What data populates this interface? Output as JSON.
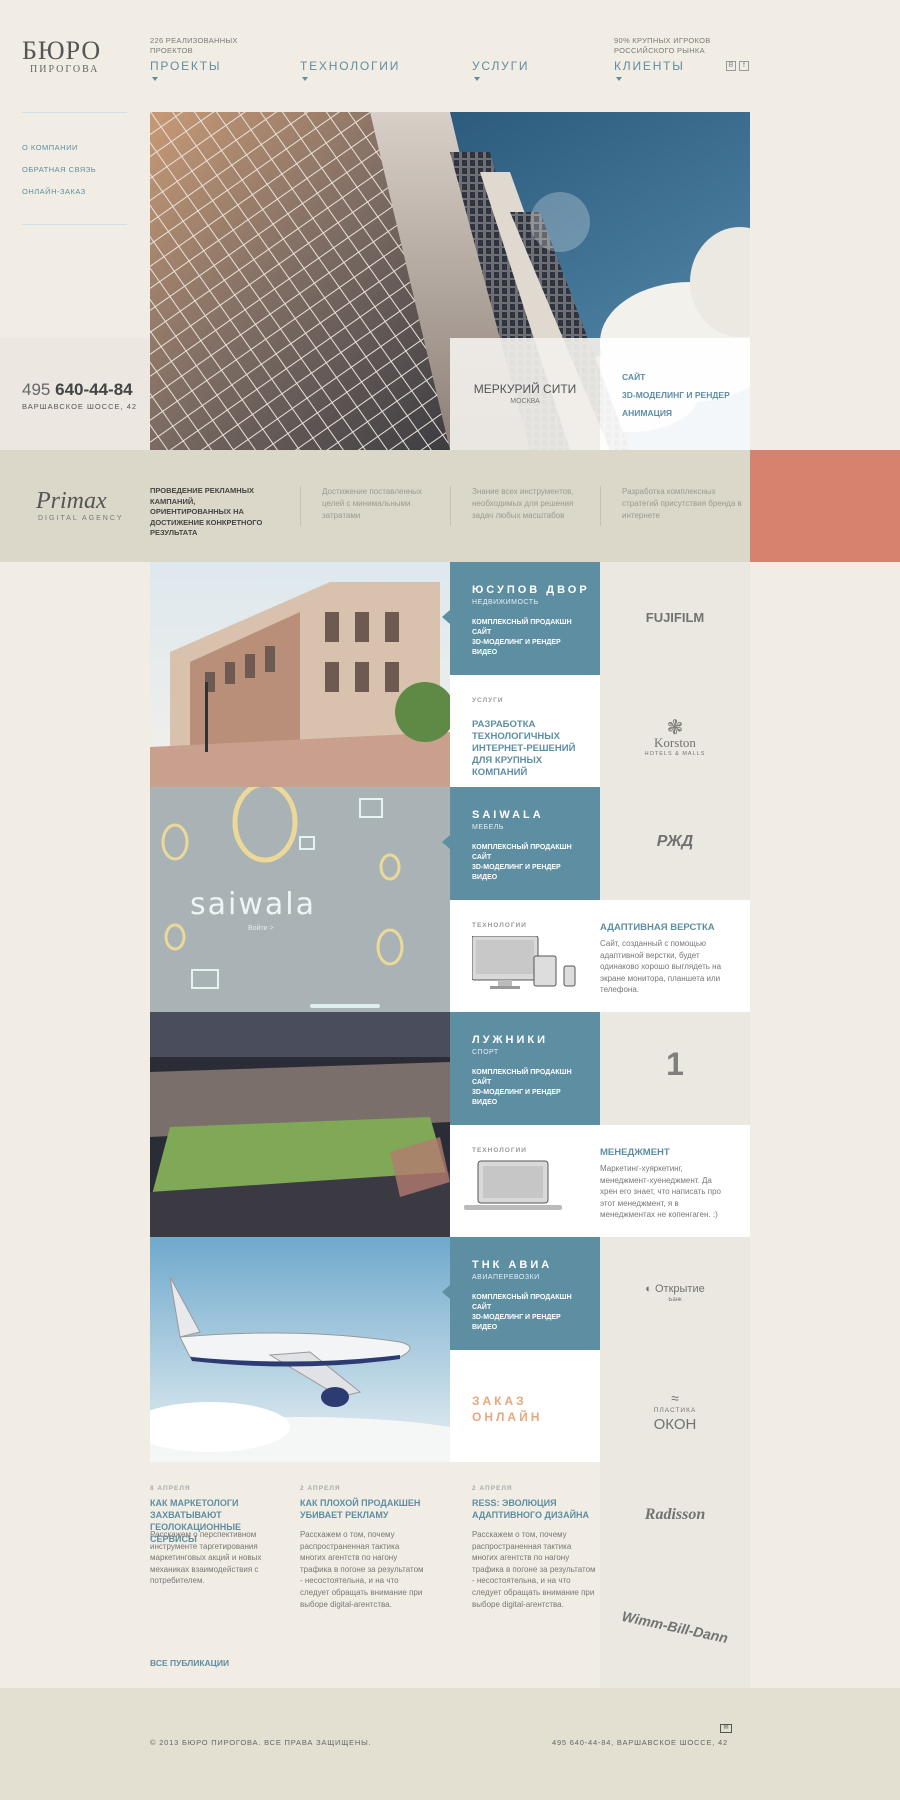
{
  "logo": {
    "line1": "БЮРО",
    "line2": "ПИРОГОВА"
  },
  "nav": [
    {
      "small": "226 РЕАЛИЗОВАННЫХ\nПРОЕКТОВ",
      "label": "ПРОЕКТЫ"
    },
    {
      "small": "",
      "label": "ТЕХНОЛОГИИ"
    },
    {
      "small": "",
      "label": "УСЛУГИ"
    },
    {
      "small": "90% КРУПНЫХ ИГРОКОВ\nРОССИЙСКОГО РЫНКА",
      "label": "КЛИЕНТЫ"
    }
  ],
  "social": [
    "B",
    "f"
  ],
  "sidebar": {
    "links": [
      "О КОМПАНИИ",
      "ОБРАТНАЯ СВЯЗЬ",
      "ОНЛАЙН-ЗАКАЗ"
    ]
  },
  "contact": {
    "phone_prefix": "495",
    "phone": "640-44-84",
    "address": "ВАРШАВСКОЕ ШОССЕ, 42"
  },
  "hero": {
    "title": "МЕРКУРИЙ СИТИ",
    "city": "МОСКВА",
    "links": [
      "САЙТ",
      "3D-МОДЕЛИНГ И РЕНДЕР",
      "АНИМАЦИЯ"
    ]
  },
  "partner": {
    "name": "Primax",
    "tagline": "DIGITAL AGENCY",
    "intro": "ПРОВЕДЕНИЕ РЕКЛАМНЫХ КАМПАНИЙ, ОРИЕНТИРОВАННЫХ НА ДОСТИЖЕНИЕ КОНКРЕТНОГО РЕЗУЛЬТАТА",
    "points": [
      "Достижение поставленных целей с минимальными затратами",
      "Знание всех инструментов, необходимых для решения задач любых масштабов",
      "Разработка комплексных стратегий присутствия бренда в интернете"
    ]
  },
  "projects": [
    {
      "title": "ЮСУПОВ ДВОР",
      "category": "НЕДВИЖИМОСТЬ",
      "services": "КОМПЛЕКСНЫЙ ПРОДАКШН\nСАЙТ\n3D-МОДЕЛИНГ И РЕНДЕР\nВИДЕО"
    },
    {
      "title": "SAIWALA",
      "category": "МЕБЕЛЬ",
      "services": "КОМПЛЕКСНЫЙ ПРОДАКШН\nСАЙТ\n3D-МОДЕЛИНГ И РЕНДЕР\nВИДЕО"
    },
    {
      "title": "ЛУЖНИКИ",
      "category": "СПОРТ",
      "services": "КОМПЛЕКСНЫЙ ПРОДАКШН\nСАЙТ\n3D-МОДЕЛИНГ И РЕНДЕР\nВИДЕО"
    },
    {
      "title": "ТНК АВИА",
      "category": "АВИАПЕРЕВОЗКИ",
      "services": "КОМПЛЕКСНЫЙ ПРОДАКШН\nСАЙТ\n3D-МОДЕЛИНГ И РЕНДЕР\nВИДЕО"
    }
  ],
  "saiwala_image": {
    "word": "saiwala",
    "link": "Войти >"
  },
  "services_box": {
    "label": "УСЛУГИ",
    "text": "РАЗРАБОТКА\nТЕХНОЛОГИЧНЫХ\nИНТЕРНЕТ-РЕШЕНИЙ\nДЛЯ КРУПНЫХ КОМПАНИЙ"
  },
  "tech1": {
    "label": "ТЕХНОЛОГИИ",
    "title": "АДАПТИВНАЯ ВЕРСТКА",
    "text": "Сайт, созданный с помощью адаптивной верстки, будет одинаково хорошо выглядеть на экране монитора, планшета или телефона."
  },
  "tech2": {
    "label": "ТЕХНОЛОГИИ",
    "title": "МЕНЕДЖМЕНТ",
    "text": "Маркетинг-хуяркетинг, менеджмент-хуенеджмент. Да хрен его знает, что написать про этот менеджмент, я в менеджментах не копенгаген. :)"
  },
  "order": {
    "line1": "ЗАКАЗ",
    "line2": "ОНЛАЙН"
  },
  "clients": [
    "FUJIFILM",
    "Korston",
    "HOTELS & MALLS",
    "РЖД",
    "1",
    "Открытие",
    "Банк",
    "ПЛАСТИКА",
    "ОКОН",
    "Radisson",
    "Wimm-Bill-Dann"
  ],
  "news": [
    {
      "date": "8 АПРЕЛЯ",
      "title": "КАК МАРКЕТОЛОГИ ЗАХВАТЫВАЮТ ГЕОЛОКАЦИОННЫЕ СЕРВИСЫ",
      "text": "Расскажем о перспективном инструменте таргетирования маркетинговых акций и новых механиках взаимодействия с потребителем."
    },
    {
      "date": "2 АПРЕЛЯ",
      "title": "КАК ПЛОХОЙ ПРОДАКШЕН УБИВАЕТ РЕКЛАМУ",
      "text": "Расскажем о том, почему распространенная тактика многих агентств по нагону трафика в погоне за результатом - несостоятельна, и на что следует обращать внимание при выборе digital-агентства."
    },
    {
      "date": "2 АПРЕЛЯ",
      "title": "RESS: ЭВОЛЮЦИЯ АДАПТИВНОГО ДИЗАЙНА",
      "text": "Расскажем о том, почему распространенная тактика многих агентств по нагону трафика в погоне за результатом - несостоятельна, и на что следует обращать внимание при выборе digital-агентства."
    }
  ],
  "all_news": "ВСЕ ПУБЛИКАЦИИ",
  "footer": {
    "copyright": "© 2013 БЮРО ПИРОГОВА. ВСЕ ПРАВА ЗАЩИЩЕНЫ.",
    "contact": "495 640-44-84, ВАРШАВСКОЕ ШОССЕ, 42"
  },
  "colors": {
    "teal": "#5e8ea2",
    "background": "#f2ede4",
    "accent_red": "#d7826f",
    "order_orange": "#e8a77e"
  }
}
